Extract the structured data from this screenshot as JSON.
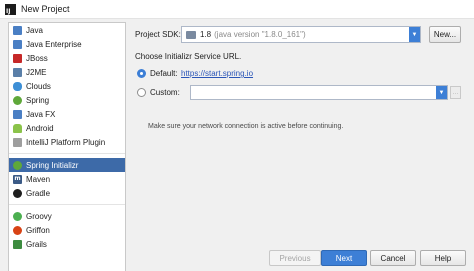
{
  "window": {
    "title": "New Project"
  },
  "sidebar": {
    "items": [
      {
        "label": "Java",
        "icon": "folder-icon",
        "color": "#4a7fc4"
      },
      {
        "label": "Java Enterprise",
        "icon": "java-ee-icon",
        "color": "#4a7fc4"
      },
      {
        "label": "JBoss",
        "icon": "jboss-icon",
        "color": "#c62828"
      },
      {
        "label": "J2ME",
        "icon": "j2me-icon",
        "color": "#5a7fa8"
      },
      {
        "label": "Clouds",
        "icon": "cloud-icon",
        "color": "#3d8fd6"
      },
      {
        "label": "Spring",
        "icon": "spring-leaf-icon",
        "color": "#5fa83a"
      },
      {
        "label": "Java FX",
        "icon": "javafx-icon",
        "color": "#4a7fc4"
      },
      {
        "label": "Android",
        "icon": "android-icon",
        "color": "#8bc34a"
      },
      {
        "label": "IntelliJ Platform Plugin",
        "icon": "plugin-icon",
        "color": "#9e9e9e"
      },
      {
        "label": "Spring Initializr",
        "icon": "spring-initializr-icon",
        "color": "#5fa83a",
        "selected": true
      },
      {
        "label": "Maven",
        "icon": "maven-icon",
        "color": "#3b5a86"
      },
      {
        "label": "Gradle",
        "icon": "gradle-icon",
        "color": "#1e1e1e"
      },
      {
        "label": "Groovy",
        "icon": "groovy-icon",
        "color": "#4caf50"
      },
      {
        "label": "Griffon",
        "icon": "griffon-icon",
        "color": "#d84315"
      },
      {
        "label": "Grails",
        "icon": "grails-icon",
        "color": "#3d8c40"
      }
    ]
  },
  "sdk": {
    "label": "Project SDK:",
    "version": "1.8",
    "detail": "(java version \"1.8.0_161\")",
    "new_button": "New..."
  },
  "service": {
    "choose_label": "Choose Initializr Service URL.",
    "default_label": "Default:",
    "default_url": "https://start.spring.io",
    "custom_label": "Custom:",
    "custom_value": "",
    "note": "Make sure your network connection is active before continuing."
  },
  "footer": {
    "previous": "Previous",
    "next": "Next",
    "cancel": "Cancel",
    "help": "Help"
  },
  "colors": {
    "accent": "#3d7fd6",
    "selection": "#3d6aa8"
  }
}
